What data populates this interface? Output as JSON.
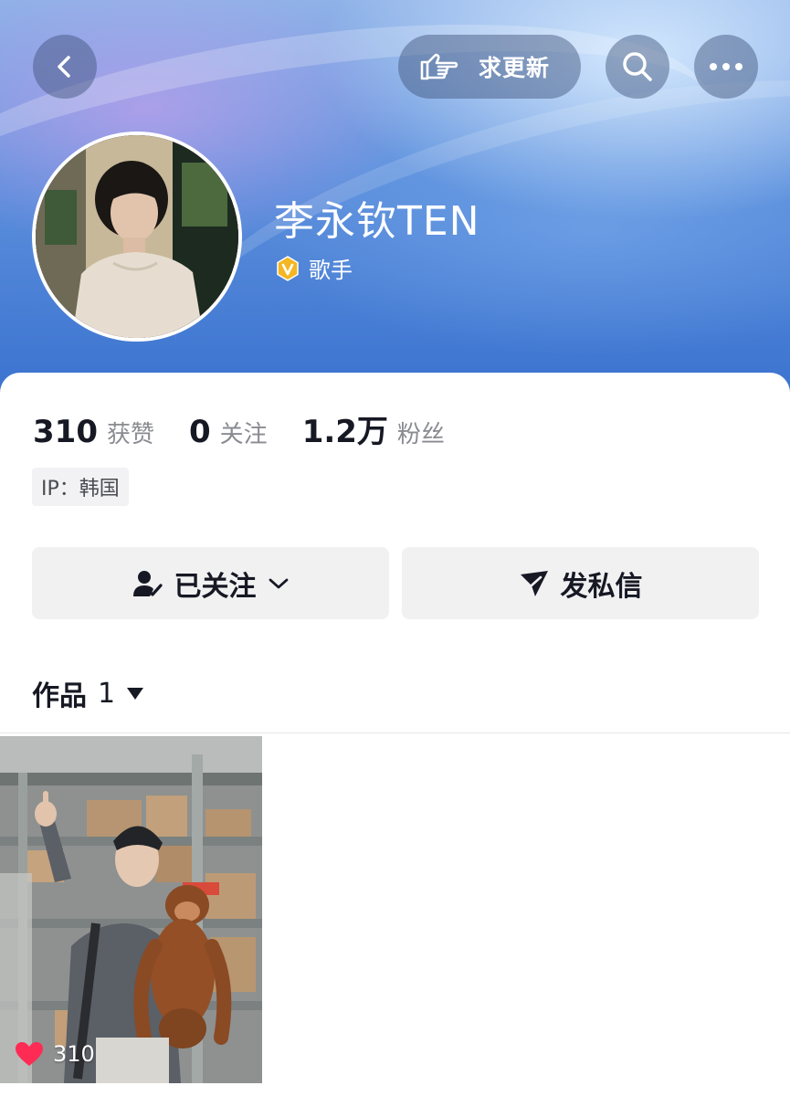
{
  "header": {
    "request_update_label": "求更新"
  },
  "profile": {
    "name": "李永钦TEN",
    "verified_role": "歌手"
  },
  "stats": [
    {
      "value": "310",
      "label": "获赞"
    },
    {
      "value": "0",
      "label": "关注"
    },
    {
      "value": "1.2万",
      "label": "粉丝"
    }
  ],
  "ip_location": "IP：韩国",
  "actions": {
    "follow_label": "已关注",
    "message_label": "发私信"
  },
  "works": {
    "label": "作品",
    "count": "1"
  },
  "videos": [
    {
      "likes": "310"
    }
  ],
  "icons": {
    "back": "chevron-left-icon",
    "request_update": "pointing-hand-icon",
    "search": "search-icon",
    "more": "more-dots-icon",
    "verified": "verified-badge-icon",
    "followed": "user-check-icon",
    "dropdown": "chevron-down-icon",
    "message": "send-icon",
    "works_dropdown": "triangle-down-icon",
    "likes": "heart-icon"
  },
  "colors": {
    "banner_top": "#8fb2e8",
    "banner_bottom": "#3a72cf",
    "verified_badge": "#f2b723",
    "heart": "#fe2c55",
    "button_bg": "#f1f1f2"
  }
}
